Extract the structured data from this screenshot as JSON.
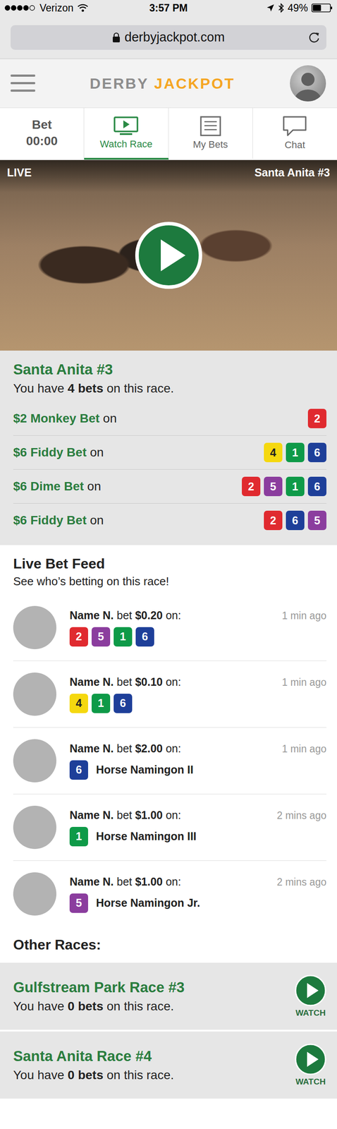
{
  "status_bar": {
    "carrier": "Verizon",
    "time": "3:57 PM",
    "battery": "49%",
    "signal_level": 0.8,
    "battery_level": 0.49
  },
  "browser": {
    "url": "derbyjackpot.com"
  },
  "header": {
    "logo_left": "DERBY",
    "logo_right": "JACKPOT"
  },
  "tabs": [
    {
      "label": "Bet",
      "sublabel": "00:00",
      "kind": "timer",
      "selected": false
    },
    {
      "label": "Watch Race",
      "kind": "watch",
      "selected": true
    },
    {
      "label": "My Bets",
      "kind": "bets",
      "selected": false
    },
    {
      "label": "Chat",
      "kind": "chat",
      "selected": false
    }
  ],
  "video": {
    "badge": "LIVE",
    "title": "Santa Anita #3"
  },
  "race": {
    "title": "Santa Anita #3",
    "prefix": "You have ",
    "bold": "4 bets",
    "suffix": " on this race.",
    "bets": [
      {
        "label": "$2 Monkey Bet",
        "on": "on",
        "horses": [
          {
            "number": "2",
            "color": "#e02a2f"
          }
        ]
      },
      {
        "label": "$6 Fiddy Bet",
        "on": "on",
        "horses": [
          {
            "number": "4",
            "color": "#f5d80f"
          },
          {
            "number": "1",
            "color": "#0e9a48"
          },
          {
            "number": "6",
            "color": "#1e3f99"
          }
        ]
      },
      {
        "label": "$6 Dime Bet",
        "on": "on",
        "horses": [
          {
            "number": "2",
            "color": "#e02a2f"
          },
          {
            "number": "5",
            "color": "#8b3d9e"
          },
          {
            "number": "1",
            "color": "#0e9a48"
          },
          {
            "number": "6",
            "color": "#1e3f99"
          }
        ]
      },
      {
        "label": "$6 Fiddy Bet",
        "on": "on",
        "horses": [
          {
            "number": "2",
            "color": "#e02a2f"
          },
          {
            "number": "6",
            "color": "#1e3f99"
          },
          {
            "number": "5",
            "color": "#8b3d9e"
          }
        ]
      }
    ]
  },
  "feed": {
    "title": "Live Bet Feed",
    "subtitle": "See who’s betting on this race!",
    "items": [
      {
        "name": "Name N.",
        "verb": "bet",
        "amount": "$0.20",
        "on": "on:",
        "time": "1 min ago",
        "horse_name": "",
        "horses": [
          {
            "number": "2",
            "color": "#e02a2f"
          },
          {
            "number": "5",
            "color": "#8b3d9e"
          },
          {
            "number": "1",
            "color": "#0e9a48"
          },
          {
            "number": "6",
            "color": "#1e3f99"
          }
        ]
      },
      {
        "name": "Name N.",
        "verb": "bet",
        "amount": "$0.10",
        "on": "on:",
        "time": "1 min ago",
        "horse_name": "",
        "horses": [
          {
            "number": "4",
            "color": "#f5d80f"
          },
          {
            "number": "1",
            "color": "#0e9a48"
          },
          {
            "number": "6",
            "color": "#1e3f99"
          }
        ]
      },
      {
        "name": "Name N.",
        "verb": "bet",
        "amount": "$2.00",
        "on": "on:",
        "time": "1 min ago",
        "horse_name": "Horse Namingon II",
        "horses": [
          {
            "number": "6",
            "color": "#1e3f99"
          }
        ]
      },
      {
        "name": "Name N.",
        "verb": "bet",
        "amount": "$1.00",
        "on": "on:",
        "time": "2 mins ago",
        "horse_name": "Horse Namingon III",
        "horses": [
          {
            "number": "1",
            "color": "#0e9a48"
          }
        ]
      },
      {
        "name": "Name N.",
        "verb": "bet",
        "amount": "$1.00",
        "on": "on:",
        "time": "2 mins ago",
        "horse_name": "Horse Namingon Jr.",
        "horses": [
          {
            "number": "5",
            "color": "#8b3d9e"
          }
        ]
      }
    ]
  },
  "other_races": {
    "title": "Other Races:",
    "items": [
      {
        "title": "Gulfstream Park Race #3",
        "prefix": "You have ",
        "bold": "0 bets",
        "suffix": " on this race.",
        "button": "WATCH"
      },
      {
        "title": "Santa Anita Race #4",
        "prefix": "You have ",
        "bold": "0 bets",
        "suffix": " on this race.",
        "button": "WATCH"
      }
    ]
  }
}
